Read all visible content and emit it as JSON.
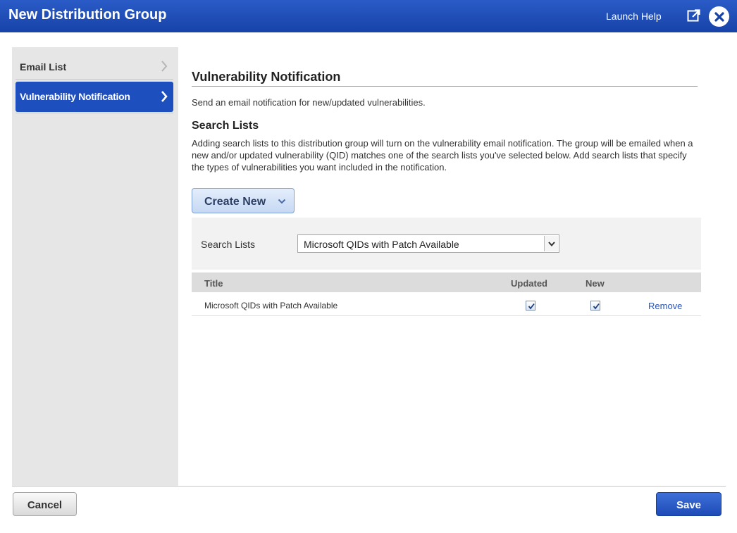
{
  "window": {
    "title": "New Distribution Group",
    "help_label": "Launch Help",
    "popout_icon": "popout-icon",
    "close_icon": "close-icon",
    "accent_color": "#1e4fbf"
  },
  "sidebar": {
    "items": [
      {
        "label": "Email List",
        "active": false
      },
      {
        "label": "Vulnerability Notification",
        "active": true
      }
    ]
  },
  "main": {
    "title": "Vulnerability Notification",
    "description": "Send an email notification for new/updated vulnerabilities.",
    "search_lists_heading": "Search Lists",
    "search_lists_text": "Adding search lists to this distribution group will turn on the vulnerability email notification. The group will be emailed when a new and/or updated vulnerability (QID) matches one of the search lists you've selected below. Add search lists that specify the types of vulnerabilities you want included in the notification.",
    "create_button": "Create New",
    "filter": {
      "label": "Search Lists",
      "selected": "Microsoft QIDs with Patch Available"
    },
    "table": {
      "columns": [
        "Title",
        "Updated",
        "New"
      ],
      "rows": [
        {
          "title": "Microsoft QIDs with Patch Available",
          "updated": true,
          "new": true,
          "action": "Remove"
        }
      ]
    }
  },
  "footer": {
    "cancel": "Cancel",
    "save": "Save"
  }
}
